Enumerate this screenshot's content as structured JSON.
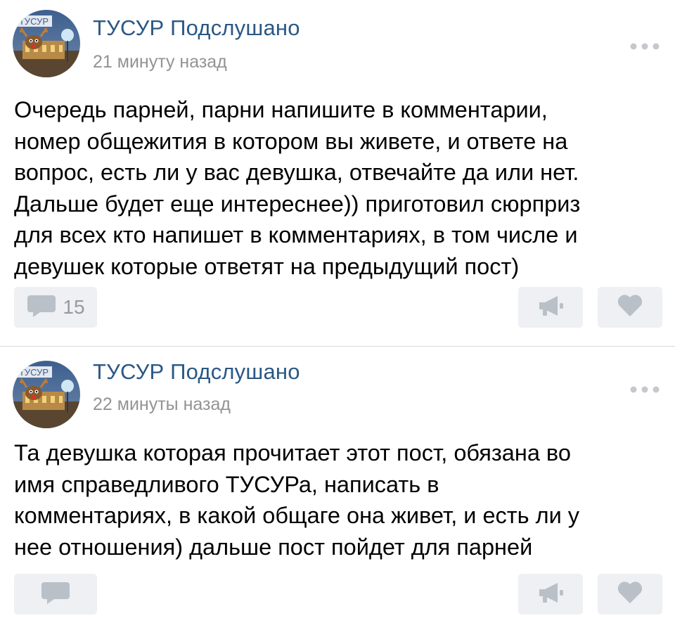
{
  "feed": {
    "posts": [
      {
        "author": "ТУСУР Подслушано",
        "time": "21 минуту назад",
        "text": "Очередь парней, парни напишите в комментарии,\nномер общежития в котором вы живете, и ответе на\nвопрос, есть ли у вас девушка, отвечайте да или нет.\nДальше будет еще интереснее)) приготовил сюрприз\nдля всех кто напишет в комментариях, в том числе и\nдевушек которые ответят на предыдущий пост)",
        "comments_count": "15",
        "avatar_label": "ТУСУР"
      },
      {
        "author": "ТУСУР Подслушано",
        "time": "22 минуты назад",
        "text": "Та девушка которая прочитает этот пост, обязана во\nимя справедливого ТУСУРа, написать в\nкомментариях, в какой общаге она живет, и есть ли у\nнее отношения) дальше пост пойдет для парней",
        "comments_count": "",
        "avatar_label": "ТУСУР"
      }
    ]
  },
  "icons": {
    "comment": "comment-icon",
    "share": "megaphone-icon",
    "like": "heart-icon",
    "more": "more-dots-icon"
  },
  "colors": {
    "author_link": "#2a5885",
    "meta_gray": "#939393",
    "button_bg": "#eef0f3",
    "icon_gray": "#b9c0c7"
  }
}
